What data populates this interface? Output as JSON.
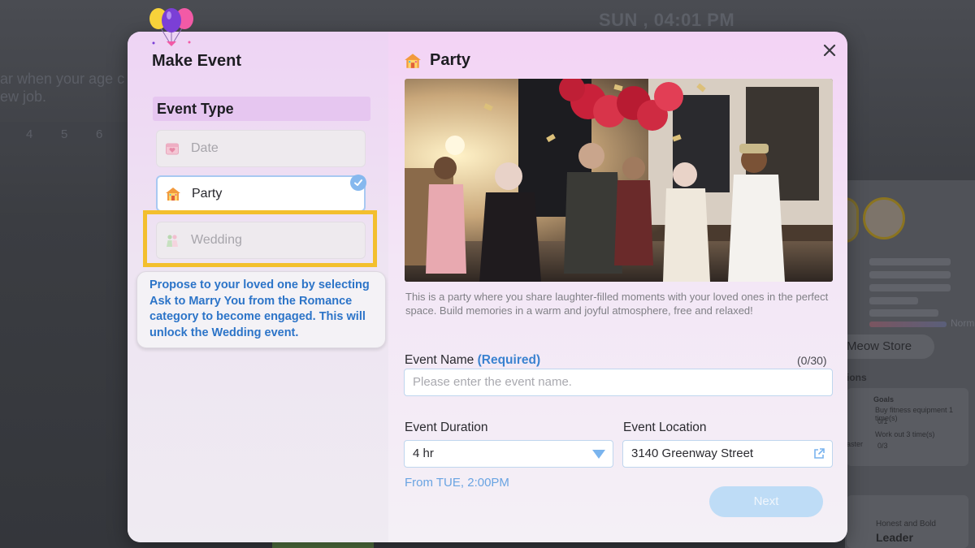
{
  "background": {
    "clock": "SUN , 04:01 PM",
    "line1": "ar when your age c",
    "line2": "ew job.",
    "numbers": [
      "4",
      "5",
      "6"
    ],
    "norm_label": "Norm",
    "store_label": "Meow Store",
    "missions_label": "ions",
    "goals_title": "Goals",
    "goal1": "Buy fitness equipment 1 time(s)",
    "goal1_progress": "0/1",
    "goal2": "Work out 3 time(s)",
    "goal2_progress": "0/3",
    "master_label": "aster",
    "trait_sub": "Honest and Bold",
    "trait_title": "Leader"
  },
  "modal": {
    "title": "Make Event",
    "close_icon": "close-icon",
    "event_type_heading": "Event Type",
    "event_types": [
      {
        "label": "Date",
        "icon": "calendar-heart-icon",
        "state": "disabled"
      },
      {
        "label": "Party",
        "icon": "party-house-icon",
        "state": "selected"
      },
      {
        "label": "Wedding",
        "icon": "wedding-couple-icon",
        "state": "locked"
      }
    ],
    "tooltip": "Propose to your loved one by selecting Ask to Marry You from the Romance category to become engaged. This will unlock the Wedding event.",
    "selected_type_title": "Party",
    "description": "This is a party where you share laughter-filled moments with your loved ones in the perfect space. Build memories in a warm and joyful atmosphere, free and relaxed!",
    "event_name_label": "Event Name",
    "event_name_required": "(Required)",
    "event_name_counter": "(0/30)",
    "event_name_placeholder": "Please enter the event name.",
    "event_duration_label": "Event Duration",
    "event_duration_value": "4 hr",
    "event_location_label": "Event Location",
    "event_location_value": "3140 Greenway Street",
    "from_text": "From TUE, 2:00PM",
    "next_label": "Next",
    "colors": {
      "accent_blue": "#3a82d0",
      "highlight_yellow": "#f3bf2e",
      "section_purple": "#e6c6f0"
    }
  }
}
